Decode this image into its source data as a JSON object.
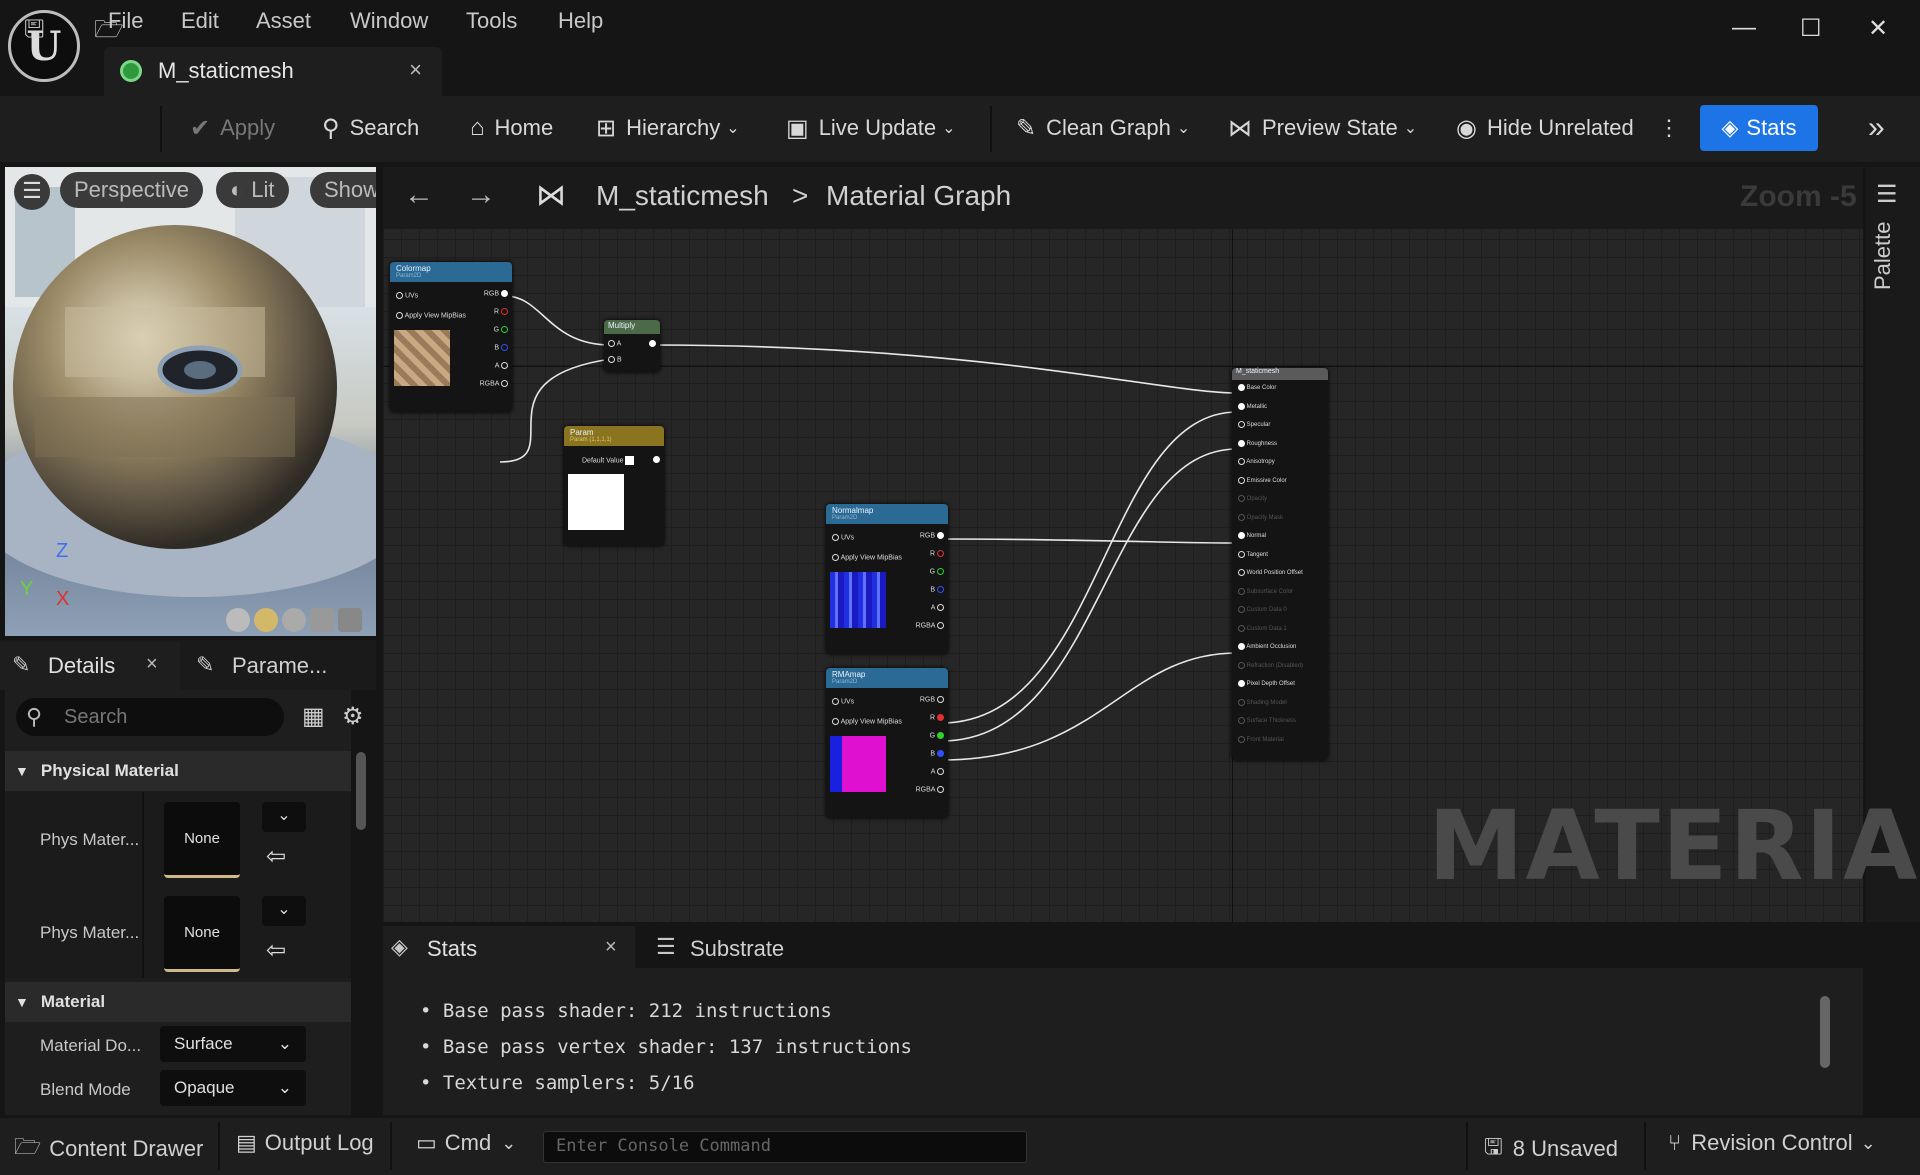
{
  "menu": [
    "File",
    "Edit",
    "Asset",
    "Window",
    "Tools",
    "Help"
  ],
  "tab": {
    "title": "M_staticmesh",
    "close": "×"
  },
  "window": {
    "minimize": "—",
    "maximize": "☐",
    "close": "✕"
  },
  "toolbar": {
    "apply": "Apply",
    "search": "Search",
    "home": "Home",
    "hierarchy": "Hierarchy",
    "live_update": "Live Update",
    "clean_graph": "Clean Graph",
    "preview_state": "Preview State",
    "hide_unrelated": "Hide Unrelated",
    "stats": "Stats",
    "more": "»"
  },
  "viewport": {
    "perspective": "Perspective",
    "lit": "Lit",
    "show": "Show",
    "axis_z": "Z",
    "axis_y": "Y",
    "axis_x": "X"
  },
  "details": {
    "tab_details": "Details",
    "tab_close": "×",
    "tab_params": "Parame...",
    "search_placeholder": "Search",
    "sections": [
      {
        "title": "Physical Material"
      },
      {
        "title": "Material"
      }
    ],
    "phys_rows": [
      {
        "label": "Phys Mater...",
        "value": "None"
      },
      {
        "label": "Phys Mater...",
        "value": "None"
      }
    ],
    "mat_rows": [
      {
        "label": "Material Do...",
        "value": "Surface"
      },
      {
        "label": "Blend Mode",
        "value": "Opaque"
      }
    ]
  },
  "graph": {
    "breadcrumb_root": "M_staticmesh",
    "breadcrumb_sep": ">",
    "breadcrumb_leaf": "Material Graph",
    "zoom": "Zoom -5",
    "palette": "Palette",
    "watermark": "MATERIAL",
    "nodes": {
      "colormap": {
        "title": "Colormap",
        "sub": "Param2D",
        "uvs": "UVs",
        "mip": "Apply View MipBias",
        "outs": [
          "RGB",
          "R",
          "G",
          "B",
          "A",
          "RGBA"
        ]
      },
      "multiply": {
        "title": "Multiply",
        "a": "A",
        "b": "B"
      },
      "param": {
        "title": "Param",
        "sub": "Param (1,1,1,1)",
        "default": "Default Value"
      },
      "normalmap": {
        "title": "Normalmap",
        "sub": "Param2D",
        "uvs": "UVs",
        "mip": "Apply View MipBias",
        "outs": [
          "RGB",
          "R",
          "G",
          "B",
          "A",
          "RGBA"
        ]
      },
      "rmamap": {
        "title": "RMAmap",
        "sub": "Param2D",
        "uvs": "UVs",
        "mip": "Apply View MipBias",
        "outs": [
          "RGB",
          "R",
          "G",
          "B",
          "A",
          "RGBA"
        ]
      },
      "result": {
        "title": "M_staticmesh",
        "pins": [
          "Base Color",
          "Metallic",
          "Specular",
          "Roughness",
          "Anisotropy",
          "Emissive Color",
          "Opacity",
          "Opacity Mask",
          "Normal",
          "Tangent",
          "World Position Offset",
          "Subsurface Color",
          "Custom Data 0",
          "Custom Data 1",
          "Ambient Occlusion",
          "Refraction (Disabled)",
          "Pixel Depth Offset",
          "Shading Model",
          "Surface Thickness",
          "Front Material"
        ]
      }
    }
  },
  "stats_panel": {
    "tab_stats": "Stats",
    "tab_close": "×",
    "tab_substrate": "Substrate",
    "lines": [
      "Base pass shader: 212 instructions",
      "Base pass vertex shader: 137 instructions",
      "Texture samplers: 5/16"
    ]
  },
  "bottom": {
    "content_drawer": "Content Drawer",
    "output_log": "Output Log",
    "cmd": "Cmd",
    "console_placeholder": "Enter Console Command",
    "unsaved": "8 Unsaved",
    "revision_control": "Revision Control"
  },
  "colors": {
    "accent": "#1c74e6",
    "node_texture_header": "#2b6a95",
    "node_param_header": "#8a7420",
    "node_multiply_header": "#4b6b48"
  }
}
